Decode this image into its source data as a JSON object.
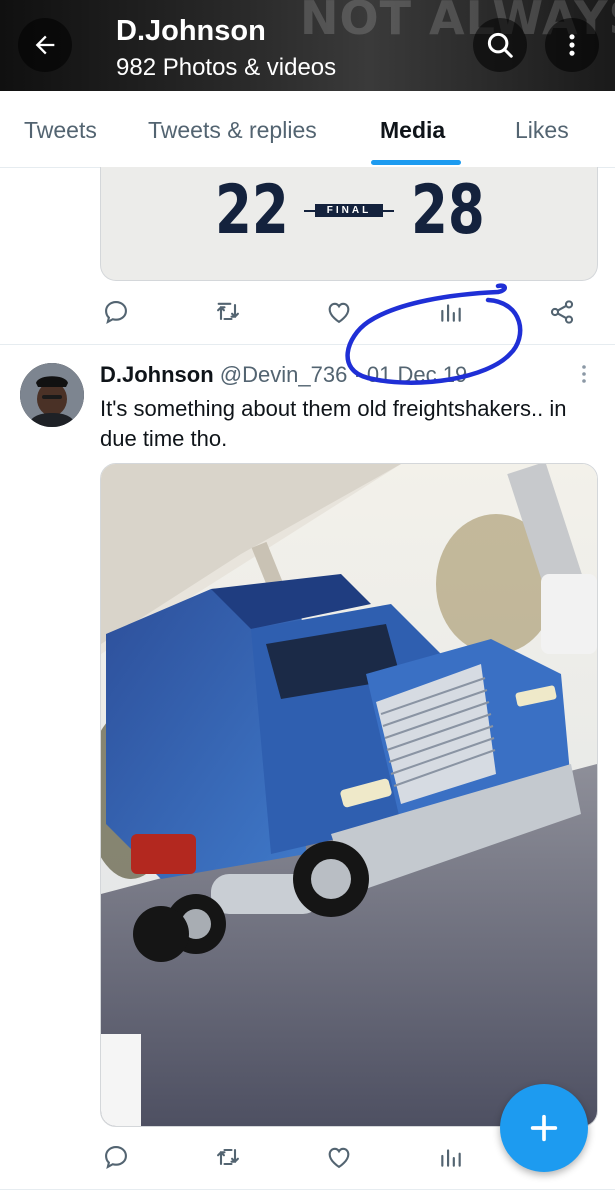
{
  "header": {
    "title": "D.Johnson",
    "subtitle": "982 Photos & videos",
    "banner_text": "NOT ALWAYS REAL TRUE FRIENDS",
    "icons": [
      "back-arrow-icon",
      "search-icon",
      "more-vertical-icon"
    ]
  },
  "tabs": [
    {
      "label": "Tweets",
      "active": false
    },
    {
      "label": "Tweets & replies",
      "active": false
    },
    {
      "label": "Media",
      "active": true
    },
    {
      "label": "Likes",
      "active": false
    }
  ],
  "previous_tweet": {
    "scoreboard": {
      "left_score": "22",
      "status": "FINAL",
      "right_score": "28"
    },
    "actions": [
      "reply-icon",
      "retweet-icon",
      "like-icon",
      "views-icon",
      "share-icon"
    ]
  },
  "tweet": {
    "name": "D.Johnson",
    "handle": "@Devin_736",
    "separator": "·",
    "date": "01 Dec 19",
    "text": "It's something about them old freightshakers.. in due time tho.",
    "media": "photo of a blue semi truck parked at a gas station",
    "actions": [
      "reply-icon",
      "retweet-icon",
      "like-icon",
      "views-icon",
      "share-icon"
    ]
  },
  "fab": {
    "icon": "plus-icon",
    "color": "#1d9bf0"
  },
  "colors": {
    "accent": "#1d9bf0",
    "annotation": "#1f2fd6",
    "text_secondary": "#536471"
  }
}
